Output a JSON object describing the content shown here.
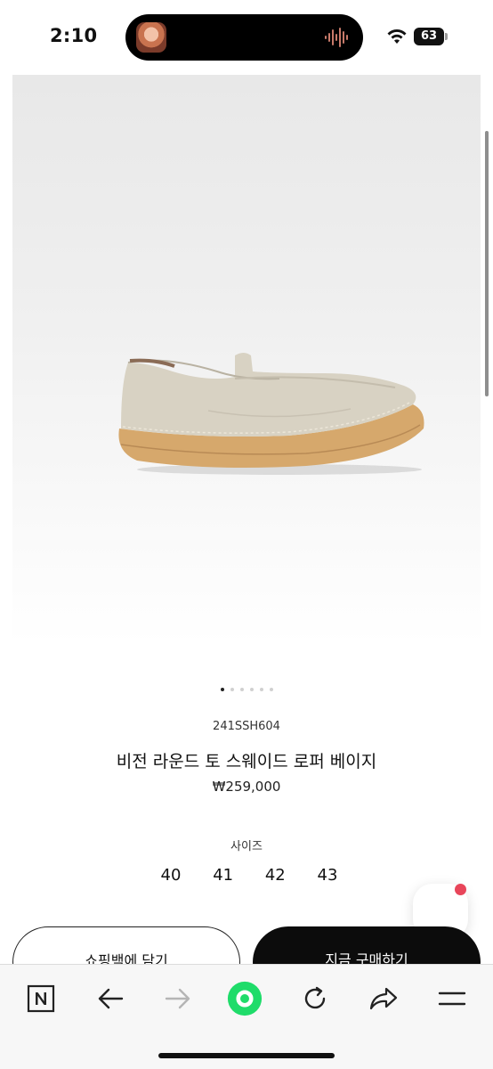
{
  "status_bar": {
    "time": "2:10",
    "battery": "63",
    "icons": [
      "music-app-avatar-icon",
      "audio-waveform-icon",
      "wifi-icon",
      "battery-icon"
    ]
  },
  "product": {
    "image_alt": "beige suede loafer",
    "carousel": {
      "count": 6,
      "active_index": 0
    },
    "sku": "241SSH604",
    "name": "비전 라운드 토 스웨이드 로퍼 베이지",
    "price": "₩259,000",
    "size_label": "사이즈",
    "sizes": [
      "40",
      "41",
      "42",
      "43"
    ]
  },
  "actions": {
    "add_to_bag": "쇼핑백에 담기",
    "buy_now": "지금 구매하기"
  },
  "toolbar": {
    "items": [
      "naver-home-icon",
      "back-arrow-icon",
      "forward-arrow-icon",
      "green-dot-icon",
      "refresh-icon",
      "share-icon",
      "menu-icon"
    ]
  },
  "colors": {
    "accent_green": "#1fdc6a",
    "badge_red": "#e8455a",
    "button_dark": "#0c0c0c"
  }
}
